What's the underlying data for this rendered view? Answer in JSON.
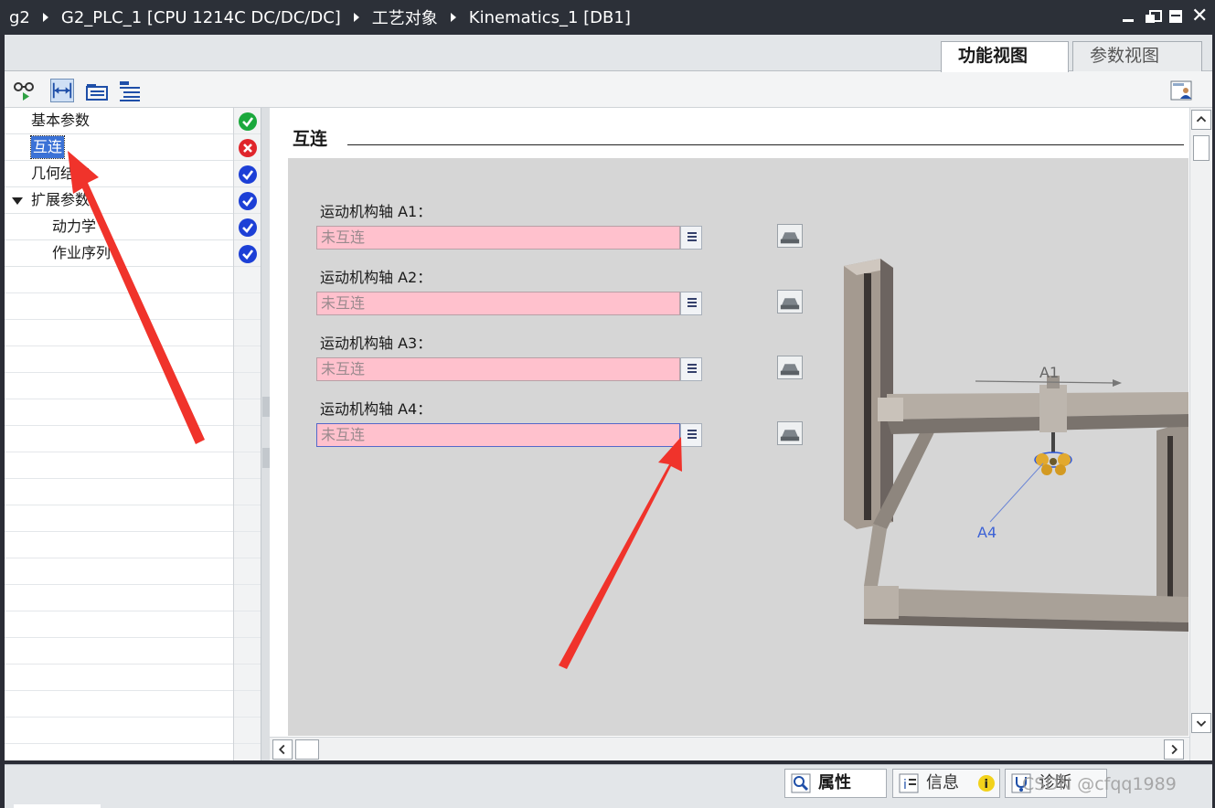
{
  "titlebar": {
    "breadcrumb": [
      "g2",
      "G2_PLC_1 [CPU 1214C DC/DC/DC]",
      "工艺对象",
      "Kinematics_1 [DB1]"
    ]
  },
  "view_tabs": {
    "function_view": "功能视图",
    "param_view": "参数视图"
  },
  "nav": {
    "items": [
      {
        "label": "基本参数",
        "status": "ok-green",
        "indent": 0
      },
      {
        "label": "互连",
        "status": "error",
        "indent": 0,
        "selected": true
      },
      {
        "label": "几何结构",
        "status": "ok-blue",
        "indent": 0
      },
      {
        "label": "扩展参数",
        "status": "ok-blue",
        "indent": 0,
        "expanded": true
      },
      {
        "label": "动力学",
        "status": "ok-blue",
        "indent": 1
      },
      {
        "label": "作业序列",
        "status": "ok-blue",
        "indent": 1
      }
    ]
  },
  "content": {
    "section_title": "互连",
    "axes": [
      {
        "label": "运动机构轴 A1：",
        "value": "未互连"
      },
      {
        "label": "运动机构轴 A2：",
        "value": "未互连"
      },
      {
        "label": "运动机构轴 A3：",
        "value": "未互连"
      },
      {
        "label": "运动机构轴 A4：",
        "value": "未互连"
      }
    ],
    "figure_labels": {
      "a1": "A1",
      "a4": "A4"
    }
  },
  "bottom_tabs": {
    "properties": "属性",
    "info": "信息",
    "diagnostics": "诊断"
  },
  "watermark": "CSDN @cfqq1989",
  "colors": {
    "titlebar_bg": "#2c3038",
    "unconnected_field": "#ffc1cd",
    "ok_green": "#1aa83c",
    "ok_blue": "#1c3fd6",
    "error_red": "#e0252b",
    "selection": "#3b72d6",
    "annotation_red": "#f0332b"
  }
}
